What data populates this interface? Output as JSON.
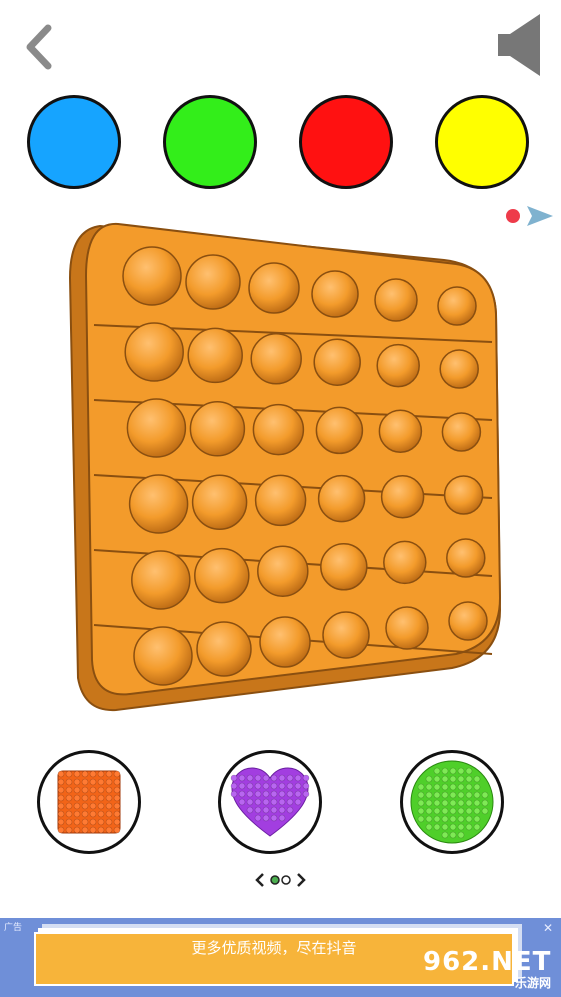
{
  "topbar": {
    "back_icon": "chevron-left-icon",
    "sound_icon": "speaker-icon"
  },
  "colors": [
    "#16a4ff",
    "#33ee1a",
    "#ff1111",
    "#ffff00"
  ],
  "board": {
    "color": "#f39b2b",
    "rows": 6,
    "cols": 6
  },
  "shapes": [
    {
      "name": "square",
      "color": "#f26418"
    },
    {
      "name": "heart",
      "color": "#a23ee0"
    },
    {
      "name": "circle",
      "color": "#4fcf2a"
    }
  ],
  "pager": {
    "count": 2,
    "active": 0
  },
  "ad": {
    "tag": "广告",
    "text": "更多优质视频，尽在抖音",
    "close": "✕",
    "watermark_main": "962.NET",
    "watermark_sub": "乐游网"
  }
}
